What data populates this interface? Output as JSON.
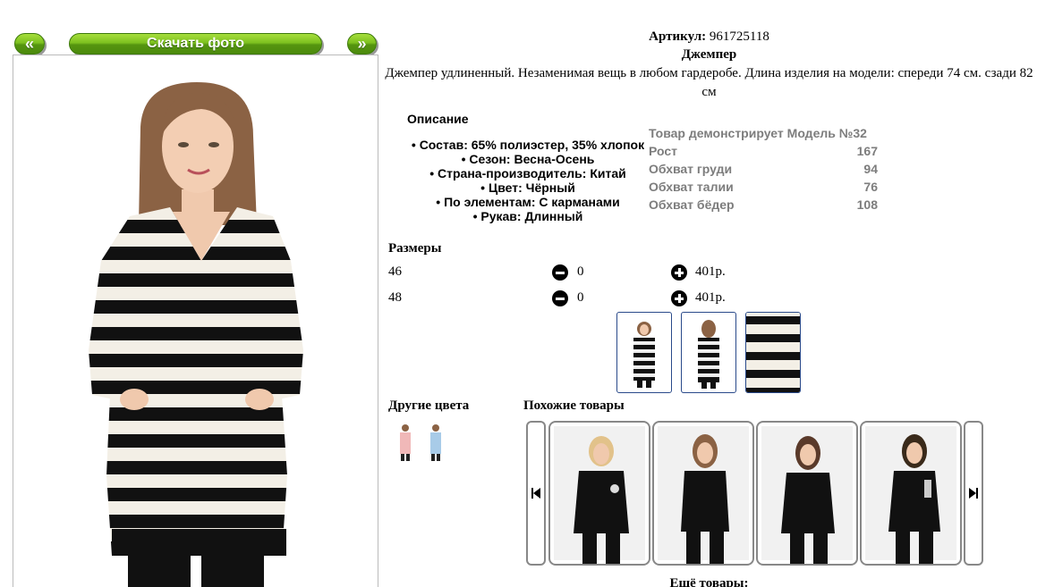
{
  "nav": {
    "prev_label": "«",
    "download_label": "Скачать фото",
    "next_label": "»"
  },
  "product": {
    "article_label": "Артикул:",
    "article_value": "961725118",
    "title": "Джемпер",
    "description": "Джемпер удлиненный. Незаменимая вещь в любом гардеробе. Длина изделия на модели: спереди 74 см. сзади 82 см"
  },
  "details": {
    "heading": "Описание",
    "attributes": [
      "Состав: 65% полиэстер, 35% хлопок",
      "Сезон: Весна-Осень",
      "Страна-производитель: Китай",
      "Цвет: Чёрный",
      "По элементам: С карманами",
      "Рукав: Длинный"
    ]
  },
  "model": {
    "heading": "Товар демонстрирует Модель №32",
    "rows": [
      {
        "label": "Рост",
        "value": "167"
      },
      {
        "label": "Обхват груди",
        "value": "94"
      },
      {
        "label": "Обхват талии",
        "value": "76"
      },
      {
        "label": "Обхват бёдер",
        "value": "108"
      }
    ]
  },
  "sizes": {
    "heading": "Размеры",
    "rows": [
      {
        "size": "46",
        "qty": "0",
        "price": "401р."
      },
      {
        "size": "48",
        "qty": "0",
        "price": "401р."
      }
    ]
  },
  "other_colors": {
    "heading": "Другие цвета"
  },
  "similar": {
    "heading": "Похожие товары"
  },
  "more_label": "Ещё товары:",
  "colors": {
    "accent_green": "#7dc11f",
    "thumb_border": "#2a4a8a",
    "model_text": "#7d7d7d"
  }
}
